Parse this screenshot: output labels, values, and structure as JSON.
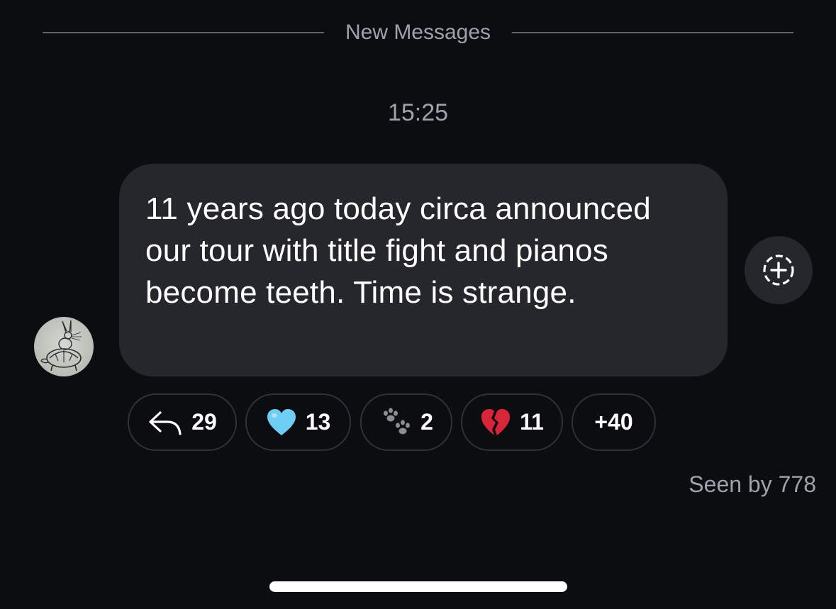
{
  "divider": {
    "label": "New Messages"
  },
  "message": {
    "timestamp": "15:25",
    "text": "11 years ago today circa announced our tour with title fight and pianos become teeth. Time is strange.",
    "avatar_icon": "turtle-rabbit-sketch-icon"
  },
  "reactions": [
    {
      "icon": "reply-arrow-icon",
      "count": "29"
    },
    {
      "icon": "light-blue-heart-icon",
      "count": "13"
    },
    {
      "icon": "paw-prints-icon",
      "count": "2"
    },
    {
      "icon": "broken-heart-icon",
      "count": "11"
    },
    {
      "icon": "",
      "count": "+40"
    }
  ],
  "add_reaction": {
    "icon": "add-reaction-icon"
  },
  "seen": {
    "text": "Seen by 778"
  },
  "colors": {
    "background": "#0c0d11",
    "bubble": "#25272c",
    "muted_text": "#9ea2ad",
    "blue_heart": "#6ecdf2",
    "broken_heart": "#d9253a"
  }
}
